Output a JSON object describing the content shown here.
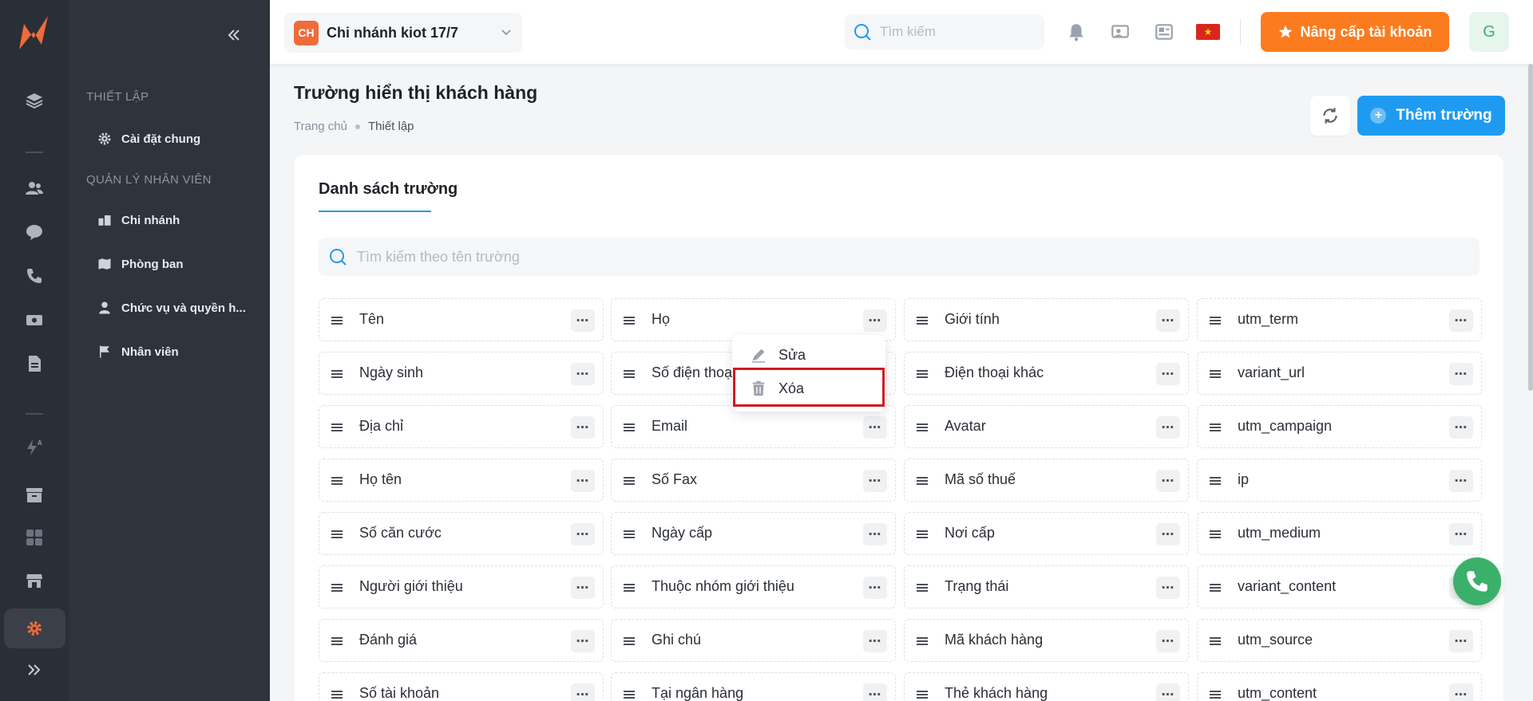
{
  "sidebar": {
    "section_setup": "THIẾT LẬP",
    "item_general": "Cài đặt chung",
    "section_staff": "QUẢN LÝ NHÂN VIÊN",
    "item_branch": "Chi nhánh",
    "item_department": "Phòng ban",
    "item_roles": "Chức vụ và quyền h...",
    "item_staff": "Nhân viên"
  },
  "topbar": {
    "branch_initials": "CH",
    "branch_name": "Chi nhánh kiot 17/7",
    "search_placeholder": "Tìm kiếm",
    "upgrade_label": "Nâng cấp tài khoản",
    "user_initial": "G"
  },
  "page": {
    "title": "Trường hiển thị khách hàng",
    "breadcrumb_home": "Trang chủ",
    "breadcrumb_current": "Thiết lập",
    "add_button": "Thêm trường"
  },
  "card": {
    "tab_label": "Danh sách trường",
    "search_placeholder": "Tìm kiếm theo tên trường"
  },
  "fields": [
    [
      "Tên",
      "Họ",
      "Giới tính",
      "utm_term"
    ],
    [
      "Ngày sinh",
      "Số điện thoại",
      "Điện thoại khác",
      "variant_url"
    ],
    [
      "Địa chỉ",
      "Email",
      "Avatar",
      "utm_campaign"
    ],
    [
      "Họ tên",
      "Số Fax",
      "Mã số thuế",
      "ip"
    ],
    [
      "Số căn cước",
      "Ngày cấp",
      "Nơi cấp",
      "utm_medium"
    ],
    [
      "Người giới thiệu",
      "Thuộc nhóm giới thiệu",
      "Trạng thái",
      "variant_content"
    ],
    [
      "Đánh giá",
      "Ghi chú",
      "Mã khách hàng",
      "utm_source"
    ],
    [
      "Số tài khoản",
      "Tại ngân hàng",
      "Thẻ khách hàng",
      "utm_content"
    ]
  ],
  "context_menu": {
    "edit_label": "Sửa",
    "delete_label": "Xóa"
  },
  "colors": {
    "accent_blue": "#1e9bf0",
    "accent_orange": "#fb7c1f",
    "highlight_red": "#d0191f"
  }
}
